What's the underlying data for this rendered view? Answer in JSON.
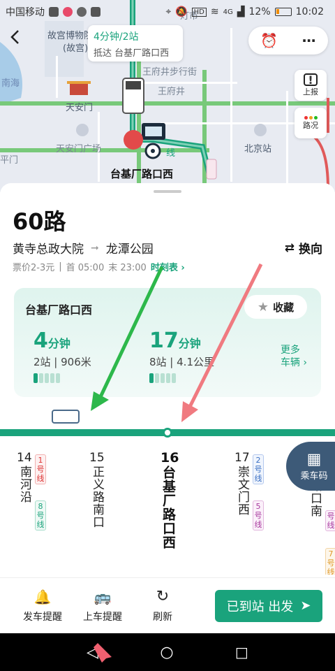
{
  "status_bar": {
    "carrier": "中国移动",
    "signal_4g": "4G",
    "hd": "HD",
    "battery": "12%",
    "time": "10:02"
  },
  "map": {
    "labels": [
      "故宫博物院",
      "(故宫)",
      "南海",
      "天安门",
      "天安门广场",
      "王府井步行街",
      "王府井",
      "北京站",
      "平门",
      "灯市"
    ],
    "bubble_time": "4分钟/2站",
    "bubble_dest": "抵达 台基厂路口西",
    "stop_label": "台基厂路口西",
    "line_tag": "线",
    "report_label": "上报",
    "traffic_label": "路况"
  },
  "route": {
    "title": "60路",
    "from": "黄寺总政大院",
    "to": "龙潭公园",
    "switch_label": "换向",
    "fare": "票价2-3元",
    "first": "首 05:00",
    "last": "末 23:00",
    "timetable": "时刻表"
  },
  "card": {
    "stop": "台基厂路口西",
    "fav": "收藏",
    "eta1_min": "4",
    "eta1_unit": "分钟",
    "eta1_detail": "2站 | 906米",
    "eta2_min": "17",
    "eta2_unit": "分钟",
    "eta2_detail": "8站 | 4.1公里",
    "more": "更多",
    "more2": "车辆"
  },
  "stops": [
    {
      "num": "14",
      "name": "南河沿",
      "metro": [
        {
          "line": "1号线",
          "cls": "l1"
        },
        {
          "line": "8号线",
          "cls": "l8"
        }
      ]
    },
    {
      "num": "15",
      "name": "正义路南口",
      "metro": []
    },
    {
      "num": "16",
      "name": "台基厂路口西",
      "metro": [],
      "current": true
    },
    {
      "num": "17",
      "name": "崇文门西",
      "metro": [
        {
          "line": "2号线",
          "cls": "l2"
        },
        {
          "line": "5号线",
          "cls": "l5"
        }
      ]
    },
    {
      "num": "",
      "name": "市路口南",
      "metro": [
        {
          "line": "号线",
          "cls": "l2"
        },
        {
          "line": "号线",
          "cls": "l5"
        },
        {
          "line": "7号线",
          "cls": "l7"
        }
      ]
    }
  ],
  "ride_code": "乘车码",
  "bottom": {
    "remind_depart": "发车提醒",
    "remind_board": "上车提醒",
    "refresh": "刷新",
    "go": "已到站 出发"
  },
  "colors": {
    "accent": "#1aa37c",
    "annotation_green": "#2db84b",
    "annotation_red": "#f07a80"
  }
}
